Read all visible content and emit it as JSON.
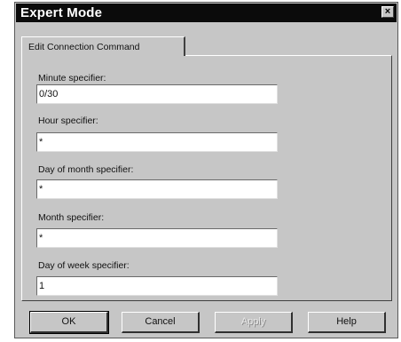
{
  "window": {
    "title": "Expert Mode",
    "close_glyph": "×"
  },
  "tab": {
    "label": "Edit Connection Command"
  },
  "fields": [
    {
      "label": "Minute specifier:",
      "value": "0/30"
    },
    {
      "label": "Hour specifier:",
      "value": "*"
    },
    {
      "label": "Day of month specifier:",
      "value": "*"
    },
    {
      "label": "Month specifier:",
      "value": "*"
    },
    {
      "label": "Day of week specifier:",
      "value": "1"
    }
  ],
  "buttons": {
    "ok": "OK",
    "cancel": "Cancel",
    "apply": "Apply",
    "help": "Help"
  }
}
